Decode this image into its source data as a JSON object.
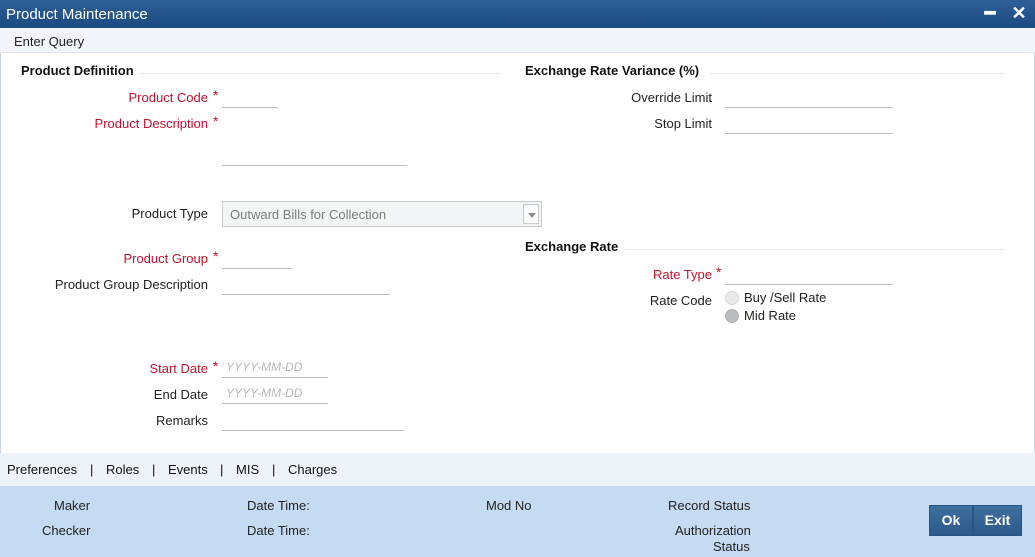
{
  "window": {
    "title": "Product Maintenance",
    "minimize_glyph": "━",
    "close_glyph": "✕"
  },
  "menu": {
    "enter_query": "Enter Query"
  },
  "product_definition": {
    "heading": "Product Definition",
    "product_code_label": "Product Code",
    "product_code_value": "",
    "product_description_label": "Product Description",
    "product_description_value": "",
    "product_type_label": "Product Type",
    "product_type_value": "Outward Bills for Collection",
    "product_group_label": "Product Group",
    "product_group_value": "",
    "product_group_description_label": "Product Group Description",
    "product_group_description_value": "",
    "start_date_label": "Start Date",
    "start_date_placeholder": "YYYY-MM-DD",
    "end_date_label": "End Date",
    "end_date_placeholder": "YYYY-MM-DD",
    "remarks_label": "Remarks",
    "remarks_value": ""
  },
  "exchange_rate_variance": {
    "heading": "Exchange Rate Variance (%)",
    "override_limit_label": "Override Limit",
    "override_limit_value": "",
    "stop_limit_label": "Stop Limit",
    "stop_limit_value": ""
  },
  "exchange_rate": {
    "heading": "Exchange Rate",
    "rate_type_label": "Rate Type",
    "rate_type_value": "",
    "rate_code_label": "Rate Code",
    "rate_code_options": [
      "Buy /Sell Rate",
      "Mid Rate"
    ],
    "rate_code_selected": "Mid Rate"
  },
  "required_marker": "*",
  "tabs": [
    "Preferences",
    "Roles",
    "Events",
    "MIS",
    "Charges"
  ],
  "tab_separator": "|",
  "footer": {
    "maker": "Maker",
    "checker": "Checker",
    "date_time_1": "Date Time:",
    "date_time_2": "Date Time:",
    "mod_no": "Mod No",
    "record_status": "Record Status",
    "authorization_status_line1": "Authorization",
    "authorization_status_line2": "Status",
    "ok_button": "Ok",
    "exit_button": "Exit"
  },
  "colors": {
    "title_bar": "#1b4a82",
    "required_label": "#c8102e",
    "footer_bg": "#c4dbf1",
    "button_bg": "#2c5a8a"
  }
}
